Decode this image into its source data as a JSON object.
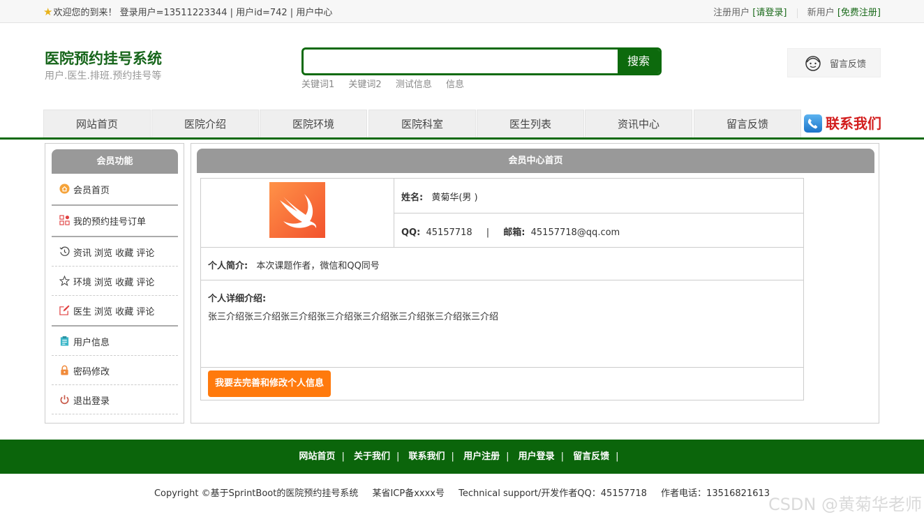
{
  "topbar": {
    "welcome": "欢迎您的到来！ 登录用户=13511223344 | 用户id=742 | 用户中心",
    "reg_user": "注册用户",
    "login_link": "[请登录]",
    "new_user": "新用户",
    "register_link": "[免费注册]"
  },
  "header": {
    "title": "医院预约挂号系统",
    "subtitle": "用户.医生.排班.预约挂号等",
    "search_placeholder": "",
    "search_button": "搜索",
    "hot_words": [
      "关键词1",
      "关键词2",
      "测试信息",
      "信息"
    ],
    "feedback": "留言反馈"
  },
  "nav": {
    "items": [
      "网站首页",
      "医院介绍",
      "医院环境",
      "医院科室",
      "医生列表",
      "资讯中心",
      "留言反馈"
    ],
    "contact": "联系我们"
  },
  "sidebar": {
    "title": "会员功能",
    "items": [
      {
        "label": "会员首页",
        "icon": "home-icon"
      },
      {
        "label": "我的预约挂号订单",
        "icon": "order-icon"
      },
      {
        "label": "资讯 浏览 收藏 评论",
        "icon": "history-icon"
      },
      {
        "label": "环境 浏览 收藏 评论",
        "icon": "star-icon"
      },
      {
        "label": "医生 浏览 收藏 评论",
        "icon": "edit-icon"
      },
      {
        "label": "用户信息",
        "icon": "clipboard-icon"
      },
      {
        "label": "密码修改",
        "icon": "lock-icon"
      },
      {
        "label": "退出登录",
        "icon": "power-icon"
      }
    ]
  },
  "main": {
    "title": "会员中心首页",
    "name_label": "姓名:",
    "name_value": "黄菊华(男 )",
    "qq_label": "QQ:",
    "qq_value": "45157718",
    "divider": "|",
    "email_label": "邮箱:",
    "email_value": "45157718@qq.com",
    "intro_label": "个人简介:",
    "intro_value": "本次课题作者，微信和QQ同号",
    "detail_label": "个人详细介绍:",
    "detail_value": "张三介绍张三介绍张三介绍张三介绍张三介绍张三介绍张三介绍张三介绍",
    "edit_button": "我要去完善和修改个人信息"
  },
  "footer": {
    "links": [
      "网站首页",
      "关于我们",
      "联系我们",
      "用户注册",
      "用户登录",
      "留言反馈"
    ],
    "copyright": "Copyright ©基于SprintBoot的医院预约挂号系统",
    "icp": "某省ICP备xxxx号",
    "support": "Technical support/开发作者QQ：45157718",
    "phone": "作者电话：13516821613"
  },
  "watermark": "CSDN @黄菊华老师",
  "colors": {
    "brand_green": "#0d6a0d",
    "orange": "#ff7a0d",
    "panel_gray": "#999999",
    "contact_red": "#d21d1d"
  }
}
